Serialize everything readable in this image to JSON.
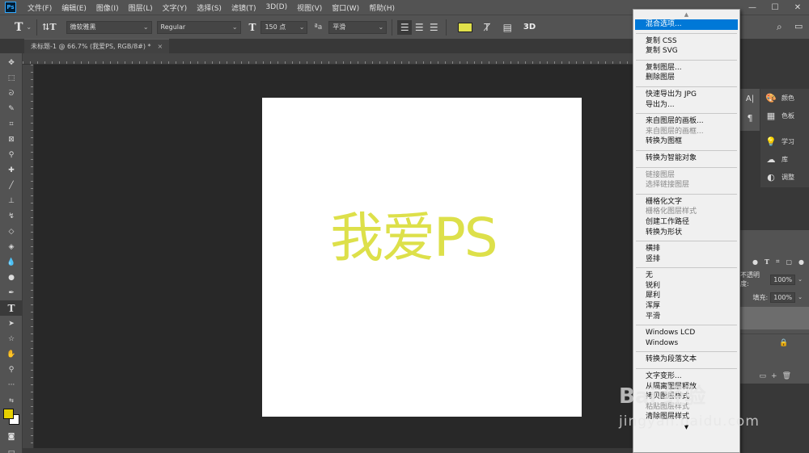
{
  "app": {
    "logo": "Ps",
    "menu": [
      "文件(F)",
      "编辑(E)",
      "图像(I)",
      "图层(L)",
      "文字(Y)",
      "选择(S)",
      "滤镜(T)",
      "3D(D)",
      "视图(V)",
      "窗口(W)",
      "帮助(H)"
    ],
    "window_controls": [
      "—",
      "☐",
      "✕"
    ]
  },
  "options": {
    "tool_icon": "T",
    "orient_icon": "⇅T",
    "font_family": "微软雅黑",
    "font_style": "Regular",
    "size_icon": "T",
    "font_size": "150 点",
    "aa_icon": "ªa",
    "antialias": "平滑",
    "text_color": "#e0e04a",
    "threeD": "3D"
  },
  "document": {
    "tab_title": "未标题-1 @ 66.7% (我爱PS, RGB/8#) *",
    "close": "×",
    "canvas_text": "我爱PS",
    "canvas_text_color": "#dde04a"
  },
  "context_menu": {
    "top_arrow": "▲",
    "bottom_arrow": "▼",
    "groups": [
      [
        {
          "label": "混合选项...",
          "state": "highlight"
        }
      ],
      [
        {
          "label": "复制 CSS"
        },
        {
          "label": "复制 SVG"
        }
      ],
      [
        {
          "label": "复制图层..."
        },
        {
          "label": "删除图层"
        }
      ],
      [
        {
          "label": "快速导出为 JPG"
        },
        {
          "label": "导出为..."
        }
      ],
      [
        {
          "label": "来自图层的画板..."
        },
        {
          "label": "来自图层的画框...",
          "state": "disabled"
        },
        {
          "label": "转换为图框"
        }
      ],
      [
        {
          "label": "转换为智能对象"
        }
      ],
      [
        {
          "label": "链接图层",
          "state": "disabled"
        },
        {
          "label": "选择链接图层",
          "state": "disabled"
        }
      ],
      [
        {
          "label": "栅格化文字"
        },
        {
          "label": "栅格化图层样式",
          "state": "disabled"
        },
        {
          "label": "创建工作路径"
        },
        {
          "label": "转换为形状"
        }
      ],
      [
        {
          "label": "横排"
        },
        {
          "label": "竖排"
        }
      ],
      [
        {
          "label": "无"
        },
        {
          "label": "锐利"
        },
        {
          "label": "犀利"
        },
        {
          "label": "浑厚"
        },
        {
          "label": "平滑"
        }
      ],
      [
        {
          "label": "Windows LCD"
        },
        {
          "label": "Windows"
        }
      ],
      [
        {
          "label": "转换为段落文本"
        }
      ],
      [
        {
          "label": "文字变形..."
        },
        {
          "label": "从隔离图层释放"
        },
        {
          "label": "拷贝图层样式"
        },
        {
          "label": "粘贴图层样式",
          "state": "disabled"
        },
        {
          "label": "清除图层样式"
        }
      ]
    ]
  },
  "panels": {
    "col1": [
      "A|",
      "¶"
    ],
    "col2": [
      {
        "icon": "palette-icon",
        "glyph": "🎨",
        "label": "颜色"
      },
      {
        "icon": "swatches-icon",
        "glyph": "▦",
        "label": "色板"
      },
      {
        "icon": "learn-icon",
        "glyph": "💡",
        "label": "学习"
      },
      {
        "icon": "library-icon",
        "glyph": "☁",
        "label": "库"
      },
      {
        "icon": "adjust-icon",
        "glyph": "◐",
        "label": "调整"
      }
    ],
    "layers": {
      "opacity_label": "不透明度:",
      "opacity_value": "100%",
      "fill_label": "填充:",
      "fill_value": "100%",
      "lock_icon": "🔒",
      "footer_icons": [
        "▭",
        "+",
        "🗑"
      ]
    }
  },
  "watermark": {
    "main": "Bai 经验",
    "sub": "jingyan.baidu.com"
  }
}
